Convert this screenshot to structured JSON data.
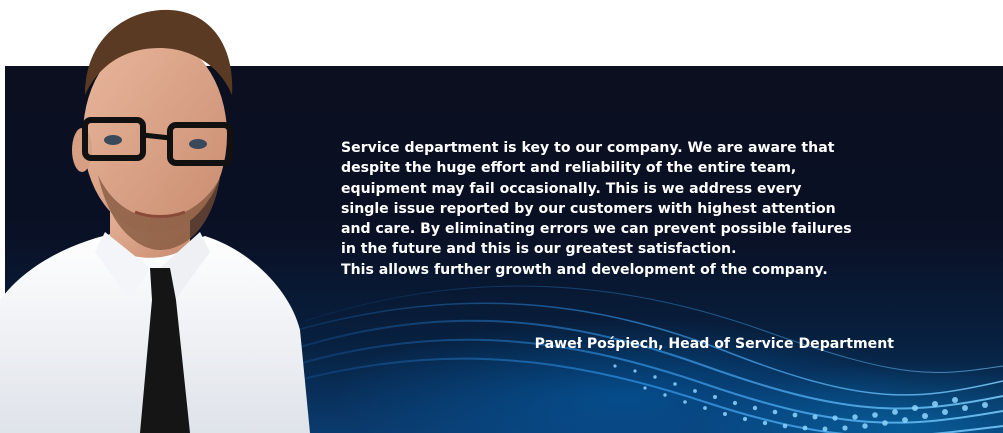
{
  "quote": {
    "text": "Service department is key to our company. We are aware that\ndespite the huge effort and reliability of the entire team,\nequipment may fail occasionally. This is we address every\nsingle issue reported by our customers with highest attention\nand care. By eliminating errors we can prevent possible failures\nin the future and this is our greatest satisfaction.\nThis allows further growth and development of the company."
  },
  "signature": {
    "text": "Paweł Pośpiech, Head of Service Department"
  },
  "colors": {
    "text": "#ffffff",
    "banner_dark": "#0b0f1f",
    "banner_blue": "#0a3b6e",
    "accent_wave": "#3aa8ff"
  },
  "portrait": {
    "icon": "person-photo-icon"
  }
}
